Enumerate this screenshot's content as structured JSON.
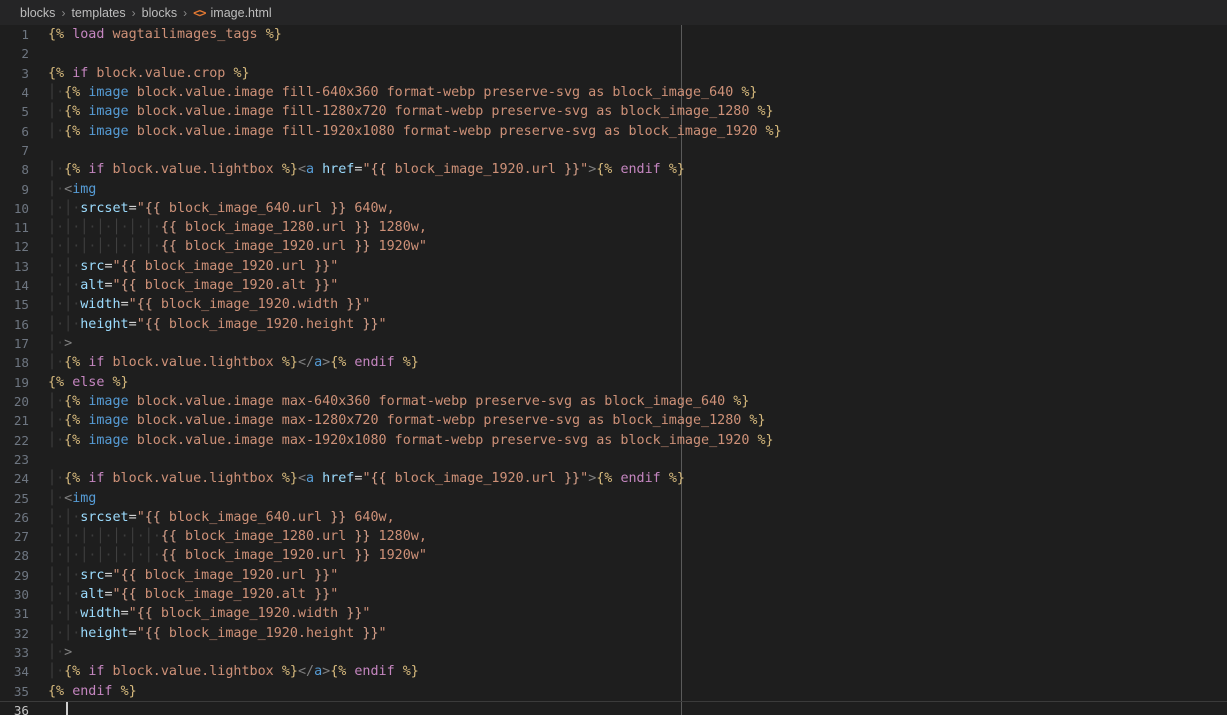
{
  "breadcrumb": {
    "name": "breadcrumb",
    "separator": "›",
    "file_icon": "<>",
    "items": [
      "blocks",
      "templates",
      "blocks"
    ],
    "file": "image.html"
  },
  "editor": {
    "active_line": 36,
    "total_lines": 36,
    "ruler_column": 80,
    "lines": [
      {
        "n": 1,
        "indent": 0,
        "tokens": [
          [
            "tag-delim",
            "{%"
          ],
          [
            "plain",
            " "
          ],
          [
            "kw",
            "load"
          ],
          [
            "plain",
            " "
          ],
          [
            "arg",
            "wagtailimages_tags"
          ],
          [
            "plain",
            " "
          ],
          [
            "tag-delim",
            "%}"
          ]
        ]
      },
      {
        "n": 2,
        "indent": 0,
        "tokens": []
      },
      {
        "n": 3,
        "indent": 0,
        "tokens": [
          [
            "tag-delim",
            "{%"
          ],
          [
            "plain",
            " "
          ],
          [
            "kw",
            "if"
          ],
          [
            "plain",
            " "
          ],
          [
            "arg",
            "block.value.crop"
          ],
          [
            "plain",
            " "
          ],
          [
            "tag-delim",
            "%}"
          ]
        ]
      },
      {
        "n": 4,
        "indent": 1,
        "tokens": [
          [
            "tag-delim",
            "{%"
          ],
          [
            "plain",
            " "
          ],
          [
            "fn",
            "image"
          ],
          [
            "plain",
            " "
          ],
          [
            "arg",
            "block.value.image fill-640x360 format-webp preserve-svg as block_image_640"
          ],
          [
            "plain",
            " "
          ],
          [
            "tag-delim",
            "%}"
          ]
        ]
      },
      {
        "n": 5,
        "indent": 1,
        "tokens": [
          [
            "tag-delim",
            "{%"
          ],
          [
            "plain",
            " "
          ],
          [
            "fn",
            "image"
          ],
          [
            "plain",
            " "
          ],
          [
            "arg",
            "block.value.image fill-1280x720 format-webp preserve-svg as block_image_1280"
          ],
          [
            "plain",
            " "
          ],
          [
            "tag-delim",
            "%}"
          ]
        ]
      },
      {
        "n": 6,
        "indent": 1,
        "tokens": [
          [
            "tag-delim",
            "{%"
          ],
          [
            "plain",
            " "
          ],
          [
            "fn",
            "image"
          ],
          [
            "plain",
            " "
          ],
          [
            "arg",
            "block.value.image fill-1920x1080 format-webp preserve-svg as block_image_1920"
          ],
          [
            "plain",
            " "
          ],
          [
            "tag-delim",
            "%}"
          ]
        ]
      },
      {
        "n": 7,
        "indent": 0,
        "tokens": []
      },
      {
        "n": 8,
        "indent": 1,
        "tokens": [
          [
            "tag-delim",
            "{%"
          ],
          [
            "plain",
            " "
          ],
          [
            "kw",
            "if"
          ],
          [
            "plain",
            " "
          ],
          [
            "arg",
            "block.value.lightbox"
          ],
          [
            "plain",
            " "
          ],
          [
            "tag-delim",
            "%}"
          ],
          [
            "hbr",
            "<"
          ],
          [
            "htag",
            "a"
          ],
          [
            "plain",
            " "
          ],
          [
            "attr",
            "href"
          ],
          [
            "eq",
            "="
          ],
          [
            "quote",
            "\""
          ],
          [
            "var-delim",
            "{{"
          ],
          [
            "arg",
            " block_image_1920.url "
          ],
          [
            "var-delim",
            "}}"
          ],
          [
            "quote",
            "\""
          ],
          [
            "hbr",
            ">"
          ],
          [
            "tag-delim",
            "{%"
          ],
          [
            "plain",
            " "
          ],
          [
            "kw",
            "endif"
          ],
          [
            "plain",
            " "
          ],
          [
            "tag-delim",
            "%}"
          ]
        ]
      },
      {
        "n": 9,
        "indent": 1,
        "tokens": [
          [
            "hbr",
            "<"
          ],
          [
            "htag",
            "img"
          ]
        ]
      },
      {
        "n": 10,
        "indent": 2,
        "tokens": [
          [
            "attr",
            "srcset"
          ],
          [
            "eq",
            "="
          ],
          [
            "quote",
            "\""
          ],
          [
            "var-delim",
            "{{"
          ],
          [
            "arg",
            " block_image_640.url "
          ],
          [
            "var-delim",
            "}}"
          ],
          [
            "quote",
            " 640w,"
          ]
        ]
      },
      {
        "n": 11,
        "indent": 7,
        "tokens": [
          [
            "var-delim",
            "{{"
          ],
          [
            "arg",
            " block_image_1280.url "
          ],
          [
            "var-delim",
            "}}"
          ],
          [
            "quote",
            " 1280w,"
          ]
        ]
      },
      {
        "n": 12,
        "indent": 7,
        "tokens": [
          [
            "var-delim",
            "{{"
          ],
          [
            "arg",
            " block_image_1920.url "
          ],
          [
            "var-delim",
            "}}"
          ],
          [
            "quote",
            " 1920w\""
          ]
        ]
      },
      {
        "n": 13,
        "indent": 2,
        "tokens": [
          [
            "attr",
            "src"
          ],
          [
            "eq",
            "="
          ],
          [
            "quote",
            "\""
          ],
          [
            "var-delim",
            "{{"
          ],
          [
            "arg",
            " block_image_1920.url "
          ],
          [
            "var-delim",
            "}}"
          ],
          [
            "quote",
            "\""
          ]
        ]
      },
      {
        "n": 14,
        "indent": 2,
        "tokens": [
          [
            "attr",
            "alt"
          ],
          [
            "eq",
            "="
          ],
          [
            "quote",
            "\""
          ],
          [
            "var-delim",
            "{{"
          ],
          [
            "arg",
            " block_image_1920.alt "
          ],
          [
            "var-delim",
            "}}"
          ],
          [
            "quote",
            "\""
          ]
        ]
      },
      {
        "n": 15,
        "indent": 2,
        "tokens": [
          [
            "attr",
            "width"
          ],
          [
            "eq",
            "="
          ],
          [
            "quote",
            "\""
          ],
          [
            "var-delim",
            "{{"
          ],
          [
            "arg",
            " block_image_1920.width "
          ],
          [
            "var-delim",
            "}}"
          ],
          [
            "quote",
            "\""
          ]
        ]
      },
      {
        "n": 16,
        "indent": 2,
        "tokens": [
          [
            "attr",
            "height"
          ],
          [
            "eq",
            "="
          ],
          [
            "quote",
            "\""
          ],
          [
            "var-delim",
            "{{"
          ],
          [
            "arg",
            " block_image_1920.height "
          ],
          [
            "var-delim",
            "}}"
          ],
          [
            "quote",
            "\""
          ]
        ]
      },
      {
        "n": 17,
        "indent": 1,
        "tokens": [
          [
            "hbr",
            ">"
          ]
        ]
      },
      {
        "n": 18,
        "indent": 1,
        "tokens": [
          [
            "tag-delim",
            "{%"
          ],
          [
            "plain",
            " "
          ],
          [
            "kw",
            "if"
          ],
          [
            "plain",
            " "
          ],
          [
            "arg",
            "block.value.lightbox"
          ],
          [
            "plain",
            " "
          ],
          [
            "tag-delim",
            "%}"
          ],
          [
            "hbr",
            "</"
          ],
          [
            "htag",
            "a"
          ],
          [
            "hbr",
            ">"
          ],
          [
            "tag-delim",
            "{%"
          ],
          [
            "plain",
            " "
          ],
          [
            "kw",
            "endif"
          ],
          [
            "plain",
            " "
          ],
          [
            "tag-delim",
            "%}"
          ]
        ]
      },
      {
        "n": 19,
        "indent": 0,
        "tokens": [
          [
            "tag-delim",
            "{%"
          ],
          [
            "plain",
            " "
          ],
          [
            "kw",
            "else"
          ],
          [
            "plain",
            " "
          ],
          [
            "tag-delim",
            "%}"
          ]
        ]
      },
      {
        "n": 20,
        "indent": 1,
        "tokens": [
          [
            "tag-delim",
            "{%"
          ],
          [
            "plain",
            " "
          ],
          [
            "fn",
            "image"
          ],
          [
            "plain",
            " "
          ],
          [
            "arg",
            "block.value.image max-640x360 format-webp preserve-svg as block_image_640"
          ],
          [
            "plain",
            " "
          ],
          [
            "tag-delim",
            "%}"
          ]
        ]
      },
      {
        "n": 21,
        "indent": 1,
        "tokens": [
          [
            "tag-delim",
            "{%"
          ],
          [
            "plain",
            " "
          ],
          [
            "fn",
            "image"
          ],
          [
            "plain",
            " "
          ],
          [
            "arg",
            "block.value.image max-1280x720 format-webp preserve-svg as block_image_1280"
          ],
          [
            "plain",
            " "
          ],
          [
            "tag-delim",
            "%}"
          ]
        ]
      },
      {
        "n": 22,
        "indent": 1,
        "tokens": [
          [
            "tag-delim",
            "{%"
          ],
          [
            "plain",
            " "
          ],
          [
            "fn",
            "image"
          ],
          [
            "plain",
            " "
          ],
          [
            "arg",
            "block.value.image max-1920x1080 format-webp preserve-svg as block_image_1920"
          ],
          [
            "plain",
            " "
          ],
          [
            "tag-delim",
            "%}"
          ]
        ]
      },
      {
        "n": 23,
        "indent": 0,
        "tokens": []
      },
      {
        "n": 24,
        "indent": 1,
        "tokens": [
          [
            "tag-delim",
            "{%"
          ],
          [
            "plain",
            " "
          ],
          [
            "kw",
            "if"
          ],
          [
            "plain",
            " "
          ],
          [
            "arg",
            "block.value.lightbox"
          ],
          [
            "plain",
            " "
          ],
          [
            "tag-delim",
            "%}"
          ],
          [
            "hbr",
            "<"
          ],
          [
            "htag",
            "a"
          ],
          [
            "plain",
            " "
          ],
          [
            "attr",
            "href"
          ],
          [
            "eq",
            "="
          ],
          [
            "quote",
            "\""
          ],
          [
            "var-delim",
            "{{"
          ],
          [
            "arg",
            " block_image_1920.url "
          ],
          [
            "var-delim",
            "}}"
          ],
          [
            "quote",
            "\""
          ],
          [
            "hbr",
            ">"
          ],
          [
            "tag-delim",
            "{%"
          ],
          [
            "plain",
            " "
          ],
          [
            "kw",
            "endif"
          ],
          [
            "plain",
            " "
          ],
          [
            "tag-delim",
            "%}"
          ]
        ]
      },
      {
        "n": 25,
        "indent": 1,
        "tokens": [
          [
            "hbr",
            "<"
          ],
          [
            "htag",
            "img"
          ]
        ]
      },
      {
        "n": 26,
        "indent": 2,
        "tokens": [
          [
            "attr",
            "srcset"
          ],
          [
            "eq",
            "="
          ],
          [
            "quote",
            "\""
          ],
          [
            "var-delim",
            "{{"
          ],
          [
            "arg",
            " block_image_640.url "
          ],
          [
            "var-delim",
            "}}"
          ],
          [
            "quote",
            " 640w,"
          ]
        ]
      },
      {
        "n": 27,
        "indent": 7,
        "tokens": [
          [
            "var-delim",
            "{{"
          ],
          [
            "arg",
            " block_image_1280.url "
          ],
          [
            "var-delim",
            "}}"
          ],
          [
            "quote",
            " 1280w,"
          ]
        ]
      },
      {
        "n": 28,
        "indent": 7,
        "tokens": [
          [
            "var-delim",
            "{{"
          ],
          [
            "arg",
            " block_image_1920.url "
          ],
          [
            "var-delim",
            "}}"
          ],
          [
            "quote",
            " 1920w\""
          ]
        ]
      },
      {
        "n": 29,
        "indent": 2,
        "tokens": [
          [
            "attr",
            "src"
          ],
          [
            "eq",
            "="
          ],
          [
            "quote",
            "\""
          ],
          [
            "var-delim",
            "{{"
          ],
          [
            "arg",
            " block_image_1920.url "
          ],
          [
            "var-delim",
            "}}"
          ],
          [
            "quote",
            "\""
          ]
        ]
      },
      {
        "n": 30,
        "indent": 2,
        "tokens": [
          [
            "attr",
            "alt"
          ],
          [
            "eq",
            "="
          ],
          [
            "quote",
            "\""
          ],
          [
            "var-delim",
            "{{"
          ],
          [
            "arg",
            " block_image_1920.alt "
          ],
          [
            "var-delim",
            "}}"
          ],
          [
            "quote",
            "\""
          ]
        ]
      },
      {
        "n": 31,
        "indent": 2,
        "tokens": [
          [
            "attr",
            "width"
          ],
          [
            "eq",
            "="
          ],
          [
            "quote",
            "\""
          ],
          [
            "var-delim",
            "{{"
          ],
          [
            "arg",
            " block_image_1920.width "
          ],
          [
            "var-delim",
            "}}"
          ],
          [
            "quote",
            "\""
          ]
        ]
      },
      {
        "n": 32,
        "indent": 2,
        "tokens": [
          [
            "attr",
            "height"
          ],
          [
            "eq",
            "="
          ],
          [
            "quote",
            "\""
          ],
          [
            "var-delim",
            "{{"
          ],
          [
            "arg",
            " block_image_1920.height "
          ],
          [
            "var-delim",
            "}}"
          ],
          [
            "quote",
            "\""
          ]
        ]
      },
      {
        "n": 33,
        "indent": 1,
        "tokens": [
          [
            "hbr",
            ">"
          ]
        ]
      },
      {
        "n": 34,
        "indent": 1,
        "tokens": [
          [
            "tag-delim",
            "{%"
          ],
          [
            "plain",
            " "
          ],
          [
            "kw",
            "if"
          ],
          [
            "plain",
            " "
          ],
          [
            "arg",
            "block.value.lightbox"
          ],
          [
            "plain",
            " "
          ],
          [
            "tag-delim",
            "%}"
          ],
          [
            "hbr",
            "</"
          ],
          [
            "htag",
            "a"
          ],
          [
            "hbr",
            ">"
          ],
          [
            "tag-delim",
            "{%"
          ],
          [
            "plain",
            " "
          ],
          [
            "kw",
            "endif"
          ],
          [
            "plain",
            " "
          ],
          [
            "tag-delim",
            "%}"
          ]
        ]
      },
      {
        "n": 35,
        "indent": 0,
        "tokens": [
          [
            "tag-delim",
            "{%"
          ],
          [
            "plain",
            " "
          ],
          [
            "kw",
            "endif"
          ],
          [
            "plain",
            " "
          ],
          [
            "tag-delim",
            "%}"
          ]
        ]
      },
      {
        "n": 36,
        "indent": 0,
        "tokens": []
      }
    ]
  }
}
